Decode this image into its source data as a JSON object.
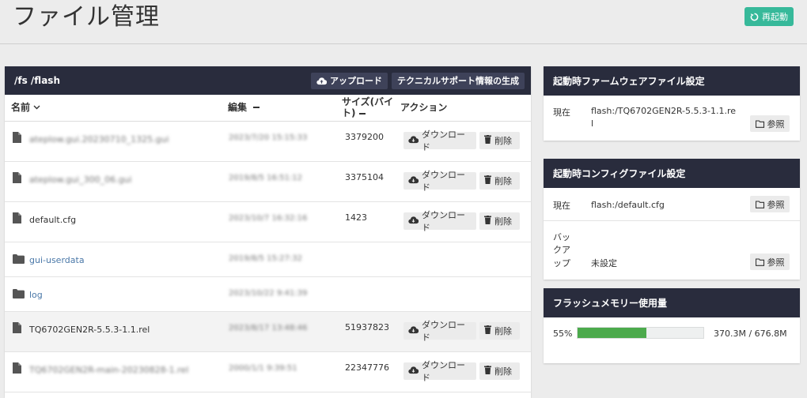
{
  "header": {
    "title": "ファイル管理",
    "restart_label": "再起動"
  },
  "file_panel": {
    "path": "/fs /flash",
    "upload_label": "アップロード",
    "techsupport_label": "テクニカルサポート情報の生成",
    "columns": {
      "name": "名前",
      "edit": "編集",
      "size": "サイズ(バイト)",
      "action": "アクション"
    },
    "download_label": "ダウンロード",
    "delete_label": "削除",
    "rows": [
      {
        "type": "file",
        "name": "ateplow.gui.20230710_1325.gui",
        "date": "2023/7/20 15:15:33",
        "size": "3379200"
      },
      {
        "type": "file",
        "name": "ateplow.gui_300_06.gui",
        "date": "2019/8/5 16:51:12",
        "size": "3375104"
      },
      {
        "type": "file",
        "name": "default.cfg",
        "date": "2023/10/7 16:32:16",
        "size": "1423"
      },
      {
        "type": "folder",
        "name": "gui-userdata",
        "date": "2019/8/5 15:27:32",
        "size": ""
      },
      {
        "type": "folder",
        "name": "log",
        "date": "2023/10/22 9:41:39",
        "size": ""
      },
      {
        "type": "file",
        "name": "TQ6702GEN2R-5.5.3-1.1.rel",
        "date": "2023/8/17 13:48:46",
        "size": "51937823"
      },
      {
        "type": "file",
        "name": "TQ6702GEN2R-main-20230828-1.rel",
        "date": "2000/1/1 9:39:51",
        "size": "22347776"
      }
    ]
  },
  "firmware_panel": {
    "title": "起動時ファームウェアファイル設定",
    "current_label": "現在",
    "current_value_line1": "flash:/TQ6702GEN2R-5.5.3-1.1.re",
    "current_value_line2": "l",
    "browse_label": "参照"
  },
  "config_panel": {
    "title": "起動時コンフィグファイル設定",
    "current_label": "現在",
    "current_value": "flash:/default.cfg",
    "backup_label_1": "バッ",
    "backup_label_2": "クア",
    "backup_label_3": "ップ",
    "backup_value": "未設定",
    "browse_label": "参照"
  },
  "memory_panel": {
    "title": "フラッシュメモリー使用量",
    "percent_label": "55%",
    "usage_fraction": 0.55,
    "usage_text": "370.3M / 676.8M"
  },
  "colors": {
    "accent": "#37b99a",
    "panel_header": "#292c3d",
    "bar_fill": "#4caa4c",
    "link": "#4a78a8"
  }
}
